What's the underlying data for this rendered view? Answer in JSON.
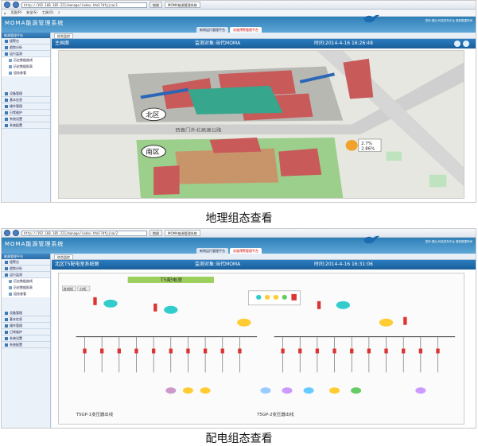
{
  "browser": {
    "url_top": "http://192.168.105.221/manage/index.html?dfyjsac1",
    "url_bottom": "http://192.168.105.221/manage/index.html?dfyjsac2",
    "tab_label": "MOMA能源管理系统",
    "cmd": [
      "页面(P)",
      "安全(S)",
      "工具(O)"
    ]
  },
  "app": {
    "title": "MOMA能源管理系统",
    "header_links": "您好:退出   科技发布平台 更新数据时间",
    "tabs": [
      "新闻运行管理平台",
      "实施预警管理平台"
    ],
    "page_tab": "综合监控"
  },
  "sidebar": {
    "head": "能源管理平台",
    "groups_top": [
      "接警台",
      "趋势分析",
      "运行监测"
    ],
    "subs": [
      "历史数据曲线",
      "历史数据报表",
      "组态查看"
    ],
    "groups_bottom": [
      "设备管理",
      "基本信息",
      "操作管理",
      "日常维护",
      "系统设置",
      "系统配置"
    ]
  },
  "geo": {
    "title": "主画面",
    "monitor": "监测对象:当代MOMA",
    "time": "时间:2014-4-16 16:26:48",
    "north": "北区",
    "south": "南区",
    "road": "西直门外北高速公路",
    "badge_lines": [
      "2.7%",
      "2.86%"
    ]
  },
  "power": {
    "title": "北区T5配电室系统图",
    "monitor": "监测对象:当代MOMA",
    "time": "时间:2014-4-16 16:31:06",
    "diagram_title": "T5配电室",
    "btn_a": "进线柜",
    "btn_b": "分柜",
    "bus_a": "T5GP-1变压器出线",
    "bus_b": "T5GP-2变压器出线"
  },
  "captions": {
    "top": "地理组态查看",
    "bottom": "配电组态查看"
  },
  "colors": {
    "header_blue": "#2a7cc0",
    "building_red": "#c85a5a",
    "teal": "#2fa58c",
    "green": "#8fc989"
  }
}
